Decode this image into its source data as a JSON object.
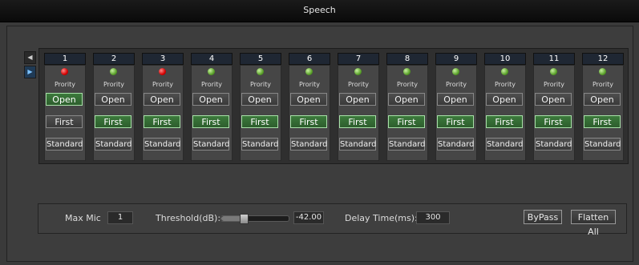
{
  "window": {
    "title": "Speech"
  },
  "nav": {
    "left_icon": "triangle-left-icon",
    "right_icon": "triangle-right-icon"
  },
  "channels": [
    {
      "num": "1",
      "led": "red",
      "priority": "Prority",
      "open": "Open",
      "first": "First",
      "standard": "Standard",
      "open_active": true,
      "first_active": false
    },
    {
      "num": "2",
      "led": "green",
      "priority": "Prority",
      "open": "Open",
      "first": "First",
      "standard": "Standard",
      "open_active": false,
      "first_active": true
    },
    {
      "num": "3",
      "led": "red",
      "priority": "Prority",
      "open": "Open",
      "first": "First",
      "standard": "Standard",
      "open_active": false,
      "first_active": true
    },
    {
      "num": "4",
      "led": "green",
      "priority": "Prority",
      "open": "Open",
      "first": "First",
      "standard": "Standard",
      "open_active": false,
      "first_active": true
    },
    {
      "num": "5",
      "led": "green",
      "priority": "Prority",
      "open": "Open",
      "first": "First",
      "standard": "Standard",
      "open_active": false,
      "first_active": true
    },
    {
      "num": "6",
      "led": "green",
      "priority": "Prority",
      "open": "Open",
      "first": "First",
      "standard": "Standard",
      "open_active": false,
      "first_active": true
    },
    {
      "num": "7",
      "led": "green",
      "priority": "Prority",
      "open": "Open",
      "first": "First",
      "standard": "Standard",
      "open_active": false,
      "first_active": true
    },
    {
      "num": "8",
      "led": "green",
      "priority": "Prority",
      "open": "Open",
      "first": "First",
      "standard": "Standard",
      "open_active": false,
      "first_active": true
    },
    {
      "num": "9",
      "led": "green",
      "priority": "Prority",
      "open": "Open",
      "first": "First",
      "standard": "Standard",
      "open_active": false,
      "first_active": true
    },
    {
      "num": "10",
      "led": "green",
      "priority": "Prority",
      "open": "Open",
      "first": "First",
      "standard": "Standard",
      "open_active": false,
      "first_active": true
    },
    {
      "num": "11",
      "led": "green",
      "priority": "Prority",
      "open": "Open",
      "first": "First",
      "standard": "Standard",
      "open_active": false,
      "first_active": true
    },
    {
      "num": "12",
      "led": "green",
      "priority": "Prority",
      "open": "Open",
      "first": "First",
      "standard": "Standard",
      "open_active": false,
      "first_active": true
    }
  ],
  "controls": {
    "max_mic_label": "Max Mic",
    "max_mic_value": "1",
    "threshold_label": "Threshold(dB):",
    "threshold_value": "-42.00",
    "threshold_level": 0.32,
    "delay_label": "Delay Time(ms):",
    "delay_value": "300",
    "bypass_label": "ByPass",
    "flatten_label": "Flatten All"
  },
  "colors": {
    "active_green": "#2e5e2e",
    "led_red": "#d40000",
    "led_green": "#5aa12a"
  }
}
